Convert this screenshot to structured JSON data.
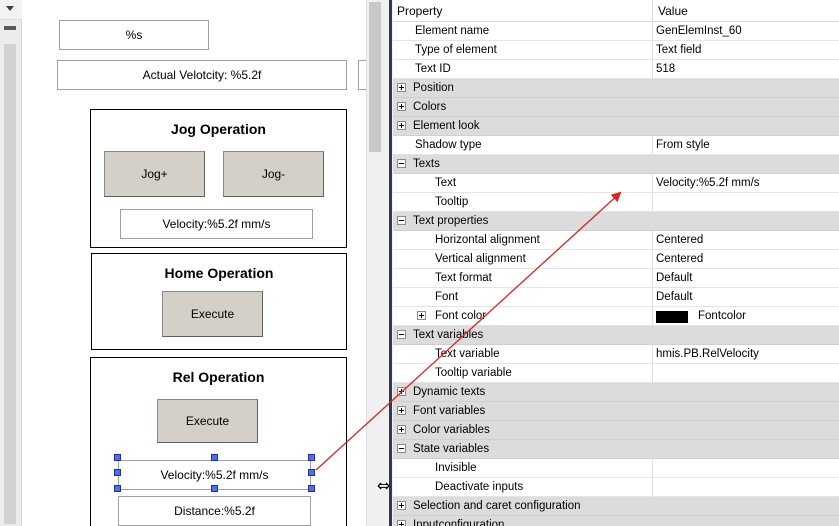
{
  "designer": {
    "field_top": "%s",
    "field_actual": "Actual Velotcity: %5.2f",
    "jog": {
      "title": "Jog Operation",
      "plus": "Jog+",
      "minus": "Jog-",
      "velocity": "Velocity:%5.2f mm/s"
    },
    "home": {
      "title": "Home Operation",
      "execute": "Execute"
    },
    "rel": {
      "title": "Rel Operation",
      "execute": "Execute",
      "velocity": "Velocity:%5.2f mm/s",
      "distance": "Distance:%5.2f"
    }
  },
  "property_grid": {
    "header_property": "Property",
    "header_value": "Value",
    "rows": [
      {
        "name": "Element name",
        "value": "GenElemInst_60",
        "level": 0,
        "cat": false
      },
      {
        "name": "Type of element",
        "value": "Text field",
        "level": 0,
        "cat": false
      },
      {
        "name": "Text ID",
        "value": "518",
        "level": 0,
        "cat": false
      },
      {
        "name": "Position",
        "value": "",
        "level": 0,
        "cat": true,
        "expander": "plus"
      },
      {
        "name": "Colors",
        "value": "",
        "level": 0,
        "cat": true,
        "expander": "plus"
      },
      {
        "name": "Element look",
        "value": "",
        "level": 0,
        "cat": true,
        "expander": "plus"
      },
      {
        "name": "Shadow type",
        "value": "From style",
        "level": 0,
        "cat": false
      },
      {
        "name": "Texts",
        "value": "",
        "level": 0,
        "cat": true,
        "expander": "minus"
      },
      {
        "name": "Text",
        "value": "Velocity:%5.2f mm/s",
        "level": 1,
        "cat": false
      },
      {
        "name": "Tooltip",
        "value": "",
        "level": 1,
        "cat": false
      },
      {
        "name": "Text properties",
        "value": "",
        "level": 0,
        "cat": true,
        "expander": "minus"
      },
      {
        "name": "Horizontal alignment",
        "value": "Centered",
        "level": 1,
        "cat": false
      },
      {
        "name": "Vertical alignment",
        "value": "Centered",
        "level": 1,
        "cat": false
      },
      {
        "name": "Text format",
        "value": "Default",
        "level": 1,
        "cat": false
      },
      {
        "name": "Font",
        "value": "Default",
        "level": 1,
        "cat": false
      },
      {
        "name": "Font color",
        "value": "Fontcolor",
        "level": 1,
        "cat": false,
        "expander": "plus",
        "swatch": "#000000"
      },
      {
        "name": "Text variables",
        "value": "",
        "level": 0,
        "cat": true,
        "expander": "minus"
      },
      {
        "name": "Text variable",
        "value": "hmis.PB.RelVelocity",
        "level": 1,
        "cat": false
      },
      {
        "name": "Tooltip variable",
        "value": "",
        "level": 1,
        "cat": false
      },
      {
        "name": "Dynamic texts",
        "value": "",
        "level": 0,
        "cat": true,
        "expander": "plus"
      },
      {
        "name": "Font variables",
        "value": "",
        "level": 0,
        "cat": true,
        "expander": "plus"
      },
      {
        "name": "Color variables",
        "value": "",
        "level": 0,
        "cat": true,
        "expander": "plus"
      },
      {
        "name": "State variables",
        "value": "",
        "level": 0,
        "cat": true,
        "expander": "minus"
      },
      {
        "name": "Invisible",
        "value": "",
        "level": 1,
        "cat": false
      },
      {
        "name": "Deactivate inputs",
        "value": "",
        "level": 1,
        "cat": false
      },
      {
        "name": "Selection and caret configuration",
        "value": "",
        "level": 0,
        "cat": true,
        "expander": "plus"
      },
      {
        "name": "Inputconfiguration",
        "value": "",
        "level": 0,
        "cat": true,
        "expander": "plus"
      }
    ]
  },
  "colors": {
    "annotation_arrow": "#e02020",
    "selection_handle": "#4a70f0",
    "category_row": "#dcdcdc",
    "button_face": "#d4d0c8"
  }
}
